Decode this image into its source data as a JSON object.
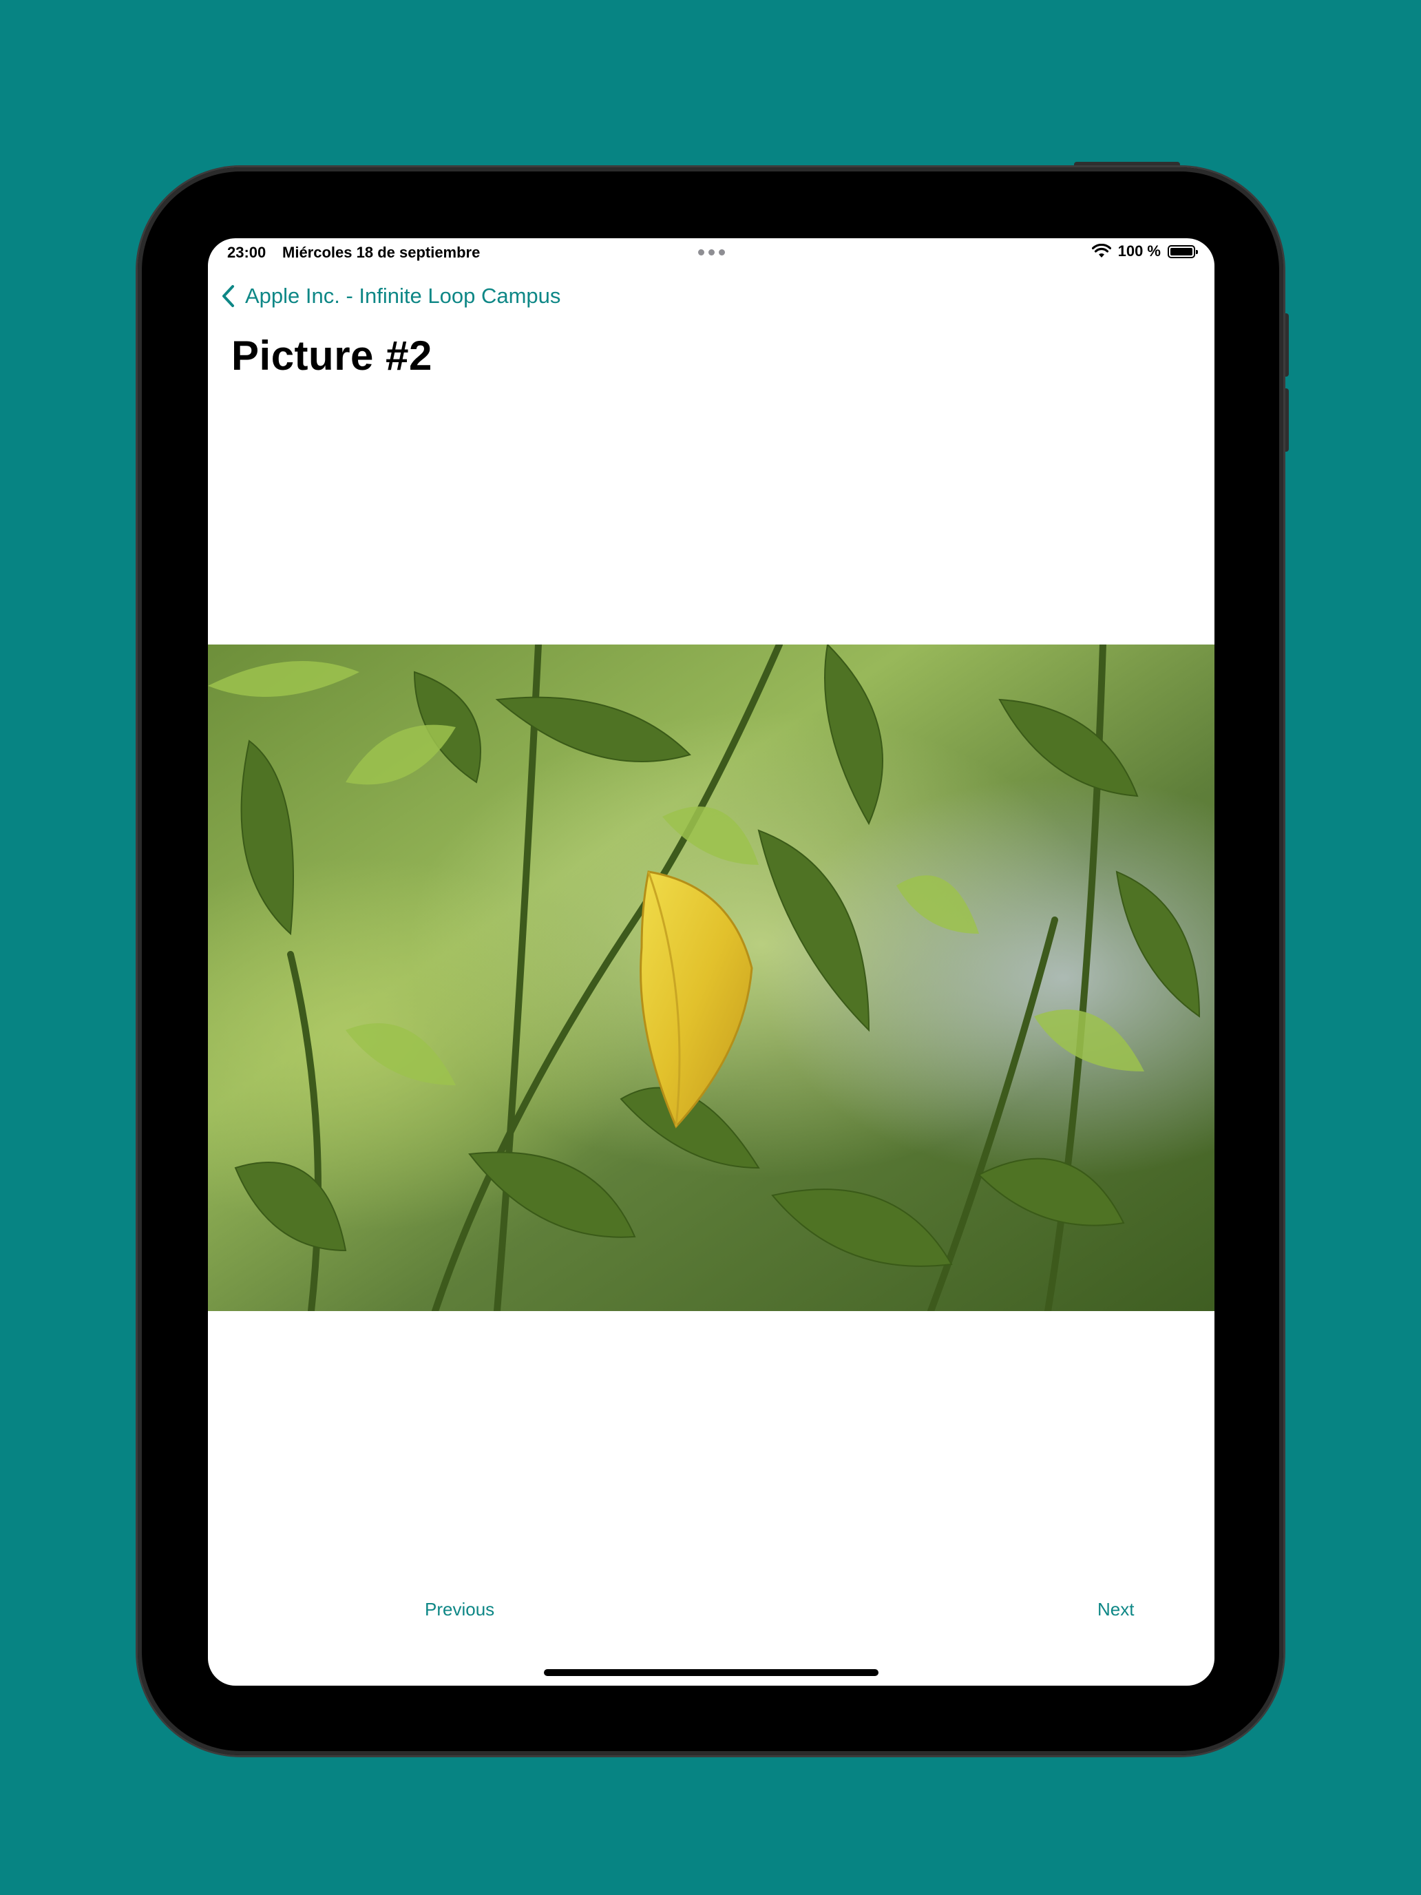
{
  "status_bar": {
    "time": "23:00",
    "date": "Miércoles 18 de septiembre",
    "battery_text": "100 %",
    "battery_level": 1.0,
    "icons": [
      "wifi-icon",
      "battery-icon",
      "multitasking-dots-icon"
    ]
  },
  "nav": {
    "back_label": "Apple Inc. - Infinite Loop Campus"
  },
  "page": {
    "title": "Picture #2"
  },
  "pager": {
    "previous_label": "Previous",
    "next_label": "Next"
  },
  "colors": {
    "background": "#078483",
    "accent": "#0e8786",
    "photo_subject": "#e0c535"
  }
}
